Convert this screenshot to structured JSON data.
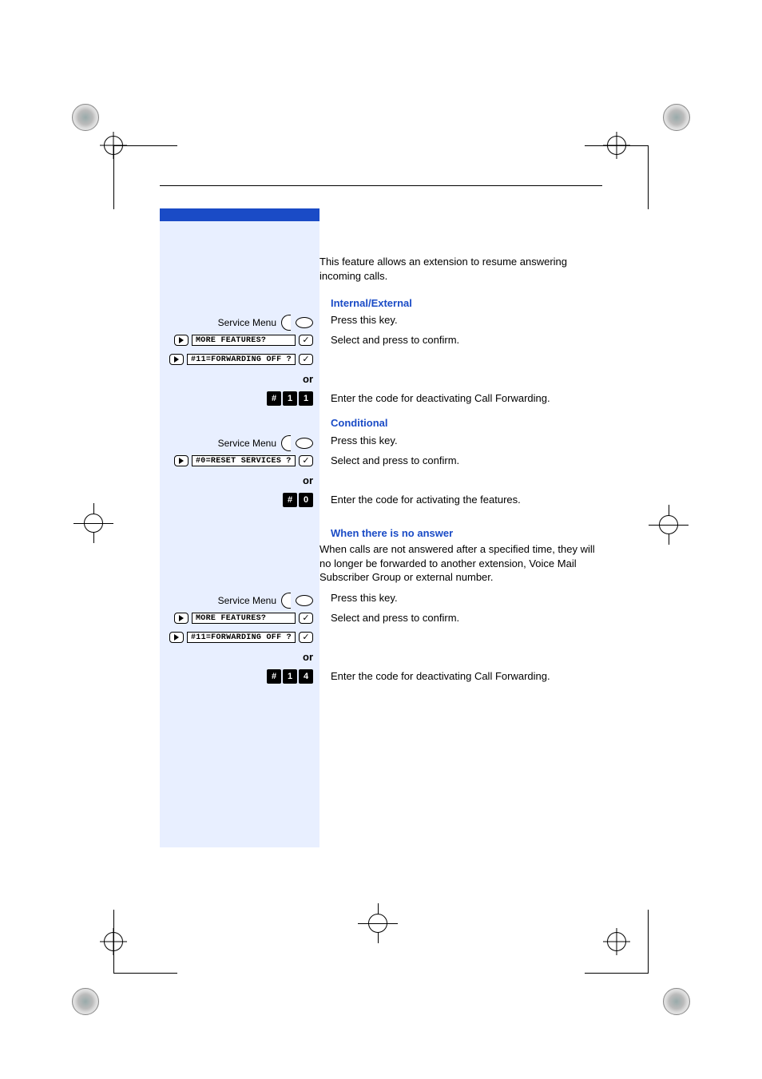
{
  "intro_text": "This feature allows an extension to resume answering incoming calls.",
  "sections": {
    "internal_external": {
      "title": "Internal/External",
      "press_key": "Press this key.",
      "select_confirm": "Select and press to confirm.",
      "or": "or",
      "code_instruction": "Enter the code for deactivating Call Forwarding.",
      "service_menu_label": "Service Menu",
      "display1": "MORE FEATURES?",
      "display2": "#11=FORWARDING OFF ?",
      "code_keys": [
        "#",
        "1",
        "1"
      ]
    },
    "conditional": {
      "title": "Conditional",
      "press_key": "Press this key.",
      "select_confirm": "Select and press to confirm.",
      "or": "or",
      "code_instruction": "Enter the code for activating the features.",
      "service_menu_label": "Service Menu",
      "display1": "#0=RESET SERVICES ?",
      "code_keys": [
        "#",
        "0"
      ]
    },
    "no_answer": {
      "title": "When there is no answer",
      "intro": "When calls are not answered after a specified time, they will no longer be forwarded to another extension, Voice Mail Subscriber Group or external number.",
      "press_key": "Press this key.",
      "select_confirm": "Select and press to confirm.",
      "or": "or",
      "code_instruction": "Enter the code for deactivating Call Forwarding.",
      "service_menu_label": "Service Menu",
      "display1": "MORE FEATURES?",
      "display2": "#11=FORWARDING OFF ?",
      "code_keys": [
        "#",
        "1",
        "4"
      ]
    }
  }
}
